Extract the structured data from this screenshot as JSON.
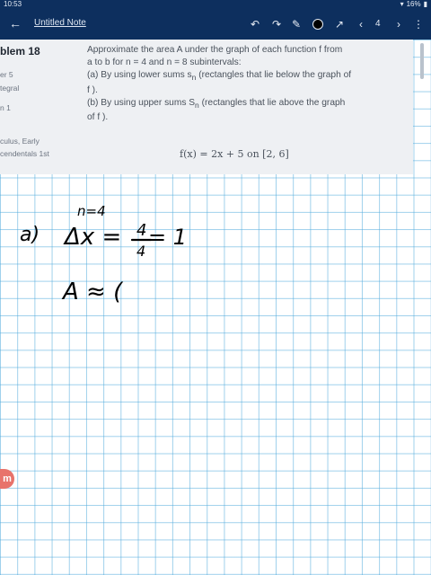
{
  "status": {
    "time": "10:53",
    "battery": "16%"
  },
  "toolbar": {
    "back_icon": "back-arrow-icon",
    "note_title": "Untitled Note",
    "page_number": "4"
  },
  "problem": {
    "side": {
      "title": "blem 18",
      "line1": "er 5",
      "line2": "tegral",
      "line3": "n 1",
      "line4": "culus, Early",
      "line5": "cendentals 1st"
    },
    "text_line1": "Approximate the area A under the graph of each function f from",
    "text_line2": "a to b for n = 4 and n = 8 subintervals:",
    "text_line3": "(a) By using lower sums s",
    "text_line3_sub": "n",
    "text_line3_end": " (rectangles that lie below the graph of",
    "text_line4": "f ).",
    "text_line5": "(b) By using upper sums S",
    "text_line5_sub": "n",
    "text_line5_end": " (rectangles that lie above the graph",
    "text_line6": "of f ).",
    "function": "f(x) = 2x + 5 on [2, 6]"
  },
  "handwriting": {
    "n_label": "n=4",
    "part_a": "a)",
    "delta_x": "Δx =",
    "frac_num": "4",
    "frac_den": "4",
    "result": "= 1",
    "approx": "A ≈ ("
  },
  "badge_letter": "m",
  "colors": {
    "toolbar_bg": "#0d2f5e",
    "grid_line": "#50aadc",
    "badge": "#e8736b"
  }
}
